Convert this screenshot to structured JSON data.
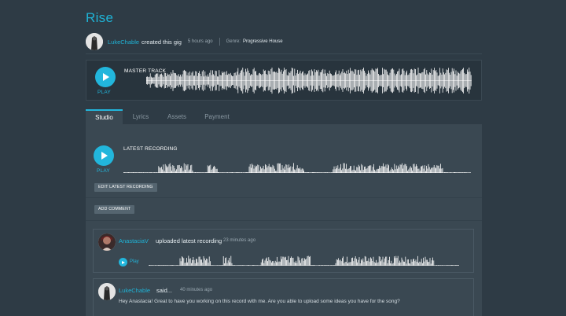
{
  "gig": {
    "title": "Rise",
    "creator": "LukeChable",
    "created_text": "created this gig",
    "time": "5 hours ago",
    "genre_label": "Genre:",
    "genre": "Progressive House"
  },
  "master": {
    "play_label": "PLAY",
    "title": "MASTER TRACK"
  },
  "tabs": [
    {
      "label": "Studio",
      "active": true
    },
    {
      "label": "Lyrics",
      "active": false
    },
    {
      "label": "Assets",
      "active": false
    },
    {
      "label": "Payment",
      "active": false
    }
  ],
  "studio": {
    "play_label": "PLAY",
    "latest_title": "LATEST RECORDING",
    "edit_button": "EDIT LATEST RECORDING",
    "add_comment_button": "ADD COMMENT"
  },
  "activity": [
    {
      "user": "AnastaciaV",
      "text": "uploaded latest recording",
      "time": "23 minutes ago",
      "play_label": "Play"
    },
    {
      "user": "LukeChable",
      "text": "said...",
      "time": "40 minutes ago",
      "body": "Hey Anastacia! Great to have you working on this record with me. Are you able to upload some ideas you have for the song?"
    }
  ],
  "colors": {
    "background": "#2e3b45",
    "panel": "#3a4852",
    "accent": "#22b6dc",
    "waveform": "#ffffff"
  },
  "icons": {
    "play": "play-icon",
    "avatar": "user-avatar"
  }
}
